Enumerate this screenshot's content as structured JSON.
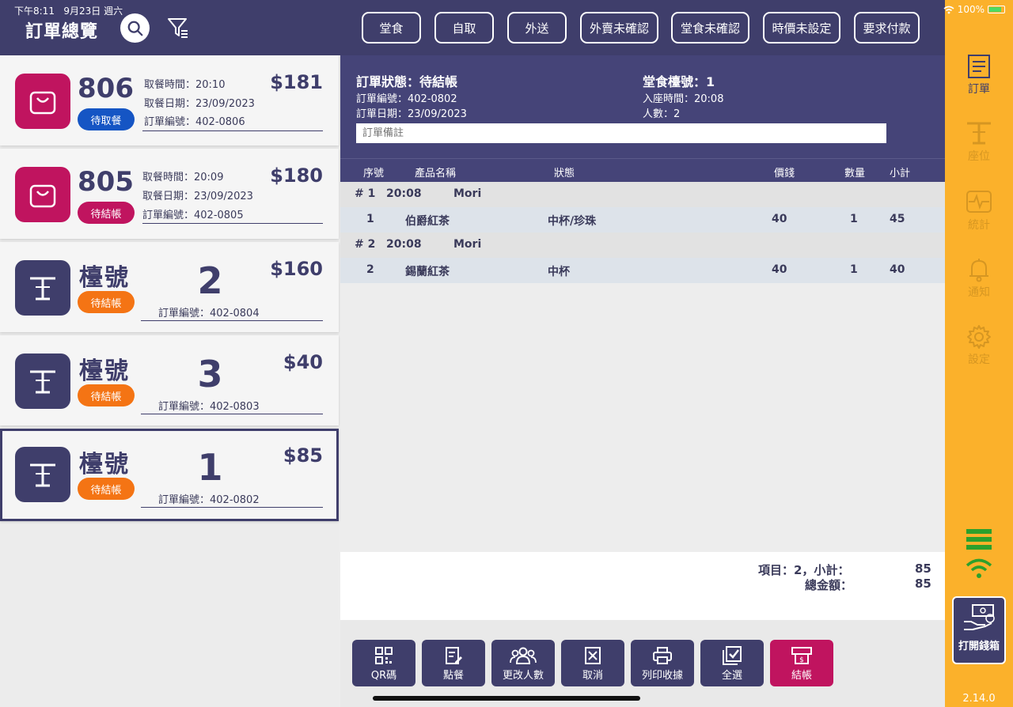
{
  "status_bar": {
    "time": "下午8:11",
    "date": "9月23日 週六",
    "battery": "100%"
  },
  "header": {
    "title": "訂單總覽",
    "filters": [
      "堂食",
      "自取",
      "外送",
      "外賣未確認",
      "堂食未確認",
      "時價未設定",
      "要求付款"
    ]
  },
  "orders": [
    {
      "number": "806",
      "badge": "待取餐",
      "time_label": "取餐時間：20:10",
      "date_label": "取餐日期：23/09/2023",
      "order_no": "訂單編號：402-0806",
      "amount": "$181"
    },
    {
      "number": "805",
      "badge": "待結帳",
      "time_label": "取餐時間：20:09",
      "date_label": "取餐日期：23/09/2023",
      "order_no": "訂單編號：402-0805",
      "amount": "$180"
    },
    {
      "label": "檯號",
      "table": "2",
      "badge": "待結帳",
      "order_no": "訂單編號：402-0804",
      "amount": "$160"
    },
    {
      "label": "檯號",
      "table": "3",
      "badge": "待結帳",
      "order_no": "訂單編號：402-0803",
      "amount": "$40"
    },
    {
      "label": "檯號",
      "table": "1",
      "badge": "待結帳",
      "order_no": "訂單編號：402-0802",
      "amount": "$85"
    }
  ],
  "detail": {
    "status": "訂單狀態：待結帳",
    "order_no": "訂單編號：402-0802",
    "order_date": "訂單日期：23/09/2023",
    "table": "堂食檯號：1",
    "seat_time": "入座時間：20:08",
    "people": "人數：2",
    "note_placeholder": "訂單備註"
  },
  "columns": [
    "序號",
    "產品名稱",
    "狀態",
    "價錢",
    "數量",
    "小計"
  ],
  "groups": [
    {
      "label": "# 1",
      "time": "20:08",
      "staff": "Mori",
      "item": {
        "seq": "1",
        "name": "伯爵紅茶",
        "status": "中杯/珍珠",
        "price": "40",
        "qty": "1",
        "subtotal": "45"
      }
    },
    {
      "label": "# 2",
      "time": "20:08",
      "staff": "Mori",
      "item": {
        "seq": "2",
        "name": "錫蘭紅茶",
        "status": "中杯",
        "price": "40",
        "qty": "1",
        "subtotal": "40"
      }
    }
  ],
  "summary": {
    "items_label": "項目：2，小計：",
    "subtotal": "85",
    "total_label": "總金額：",
    "total": "85"
  },
  "actions": [
    "QR碼",
    "點餐",
    "更改人數",
    "取消",
    "列印收據",
    "全選",
    "結帳"
  ],
  "sidebar": {
    "items": [
      "訂單",
      "座位",
      "統計",
      "通知",
      "設定"
    ],
    "cash_button": "打開錢箱",
    "version": "2.14.0"
  }
}
